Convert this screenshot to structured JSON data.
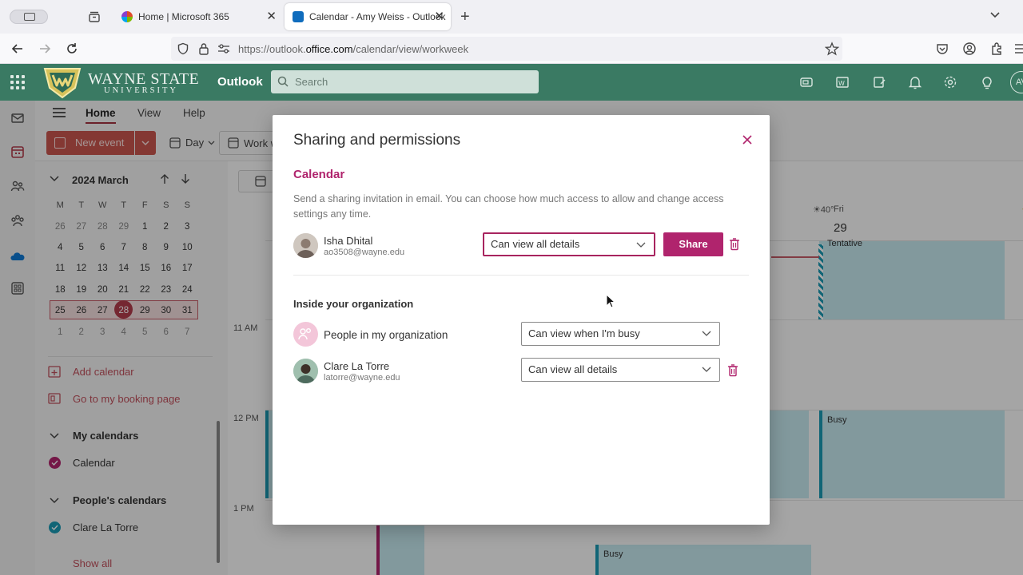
{
  "browser": {
    "tabs": [
      {
        "title": "Home | Microsoft 365"
      },
      {
        "title": "Calendar - Amy Weiss - Outlook"
      }
    ],
    "url_prefix": "https://outlook.",
    "url_domain": "office.com",
    "url_path": "/calendar/view/workweek"
  },
  "header": {
    "logo_line1": "WAYNE STATE",
    "logo_line2": "UNIVERSITY",
    "app_name": "Outlook",
    "search_placeholder": "Search",
    "avatar_initials": "AV"
  },
  "ribbon": {
    "tabs": [
      "Home",
      "View",
      "Help"
    ],
    "new_event": "New event",
    "day": "Day",
    "work_week": "Work week"
  },
  "mini_calendar": {
    "title": "2024 March",
    "weekdays": [
      "M",
      "T",
      "W",
      "T",
      "F",
      "S",
      "S"
    ],
    "weeks": [
      [
        "26",
        "27",
        "28",
        "29",
        "1",
        "2",
        "3"
      ],
      [
        "4",
        "5",
        "6",
        "7",
        "8",
        "9",
        "10"
      ],
      [
        "11",
        "12",
        "13",
        "14",
        "15",
        "16",
        "17"
      ],
      [
        "18",
        "19",
        "20",
        "21",
        "22",
        "23",
        "24"
      ],
      [
        "25",
        "26",
        "27",
        "28",
        "29",
        "30",
        "31"
      ],
      [
        "1",
        "2",
        "3",
        "4",
        "5",
        "6",
        "7"
      ]
    ],
    "today": "28"
  },
  "left_pane": {
    "add_calendar": "Add calendar",
    "booking_page": "Go to my booking page",
    "my_calendars": "My calendars",
    "calendar": "Calendar",
    "peoples_calendars": "People's calendars",
    "clare": "Clare La Torre",
    "show_all": "Show all",
    "colors": {
      "calendar": "#b0246d",
      "clare": "#1a99b4"
    }
  },
  "calendar_view": {
    "fri_label": "Fri",
    "fri_num": "29",
    "thu_weather": "40°",
    "times": [
      "11 AM",
      "12 PM",
      "1 PM"
    ],
    "events": {
      "busy1": "Busy",
      "busy2": "Busy",
      "tentative": "Tentative"
    }
  },
  "dialog": {
    "title": "Sharing and permissions",
    "section": "Calendar",
    "description": "Send a sharing invitation in email. You can choose how much access to allow and change access settings any time.",
    "invitee": {
      "name": "Isha Dhital",
      "email": "ao3508@wayne.edu",
      "permission": "Can view all details"
    },
    "share_button": "Share",
    "org_heading": "Inside your organization",
    "org_entry": {
      "name": "People in my organization",
      "permission": "Can view when I'm busy"
    },
    "shared_with": {
      "name": "Clare La Torre",
      "email": "latorre@wayne.edu",
      "permission": "Can view all details"
    },
    "accent": "#b0246d"
  }
}
